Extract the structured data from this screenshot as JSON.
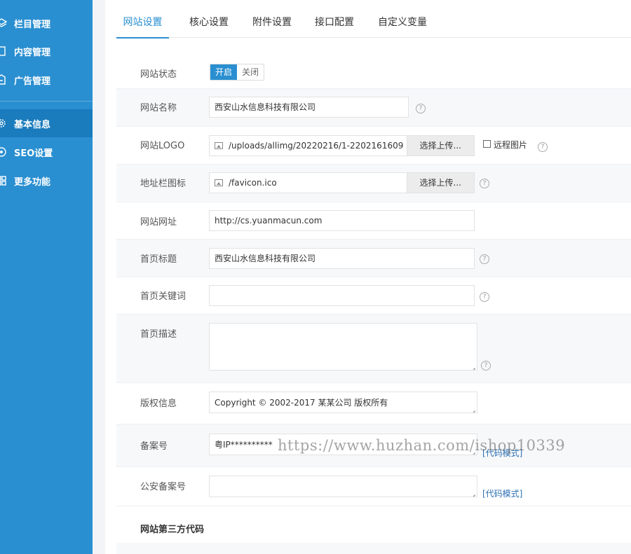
{
  "sidebar": {
    "items": [
      {
        "label": "栏目管理",
        "icon": "layers-icon"
      },
      {
        "label": "内容管理",
        "icon": "document-icon"
      },
      {
        "label": "广告管理",
        "icon": "ad-icon"
      },
      {
        "label": "基本信息",
        "icon": "gear-icon"
      },
      {
        "label": "SEO设置",
        "icon": "seo-icon"
      },
      {
        "label": "更多功能",
        "icon": "grid-icon"
      }
    ]
  },
  "tabs": [
    "网站设置",
    "核心设置",
    "附件设置",
    "接口配置",
    "自定义变量"
  ],
  "form": {
    "site_status": {
      "label": "网站状态",
      "on": "开启",
      "off": "关闭"
    },
    "site_name": {
      "label": "网站名称",
      "value": "西安山水信息科技有限公司"
    },
    "site_logo": {
      "label": "网站LOGO",
      "value": "/uploads/allimg/20220216/1-2202161609",
      "button": "选择上传...",
      "remote_label": "远程图片"
    },
    "favicon": {
      "label": "地址栏图标",
      "value": "/favicon.ico",
      "button": "选择上传..."
    },
    "site_url": {
      "label": "网站网址",
      "value": "http://cs.yuanmacun.com"
    },
    "home_title": {
      "label": "首页标题",
      "value": "西安山水信息科技有限公司"
    },
    "home_keywords": {
      "label": "首页关键词",
      "value": ""
    },
    "home_description": {
      "label": "首页描述",
      "value": ""
    },
    "copyright": {
      "label": "版权信息",
      "value": "Copyright © 2002-2017 某某公司 版权所有"
    },
    "icp": {
      "label": "备案号",
      "value": "粤IP**********",
      "code_mode": "[代码模式]"
    },
    "police_icp": {
      "label": "公安备案号",
      "value": "",
      "code_mode": "[代码模式]"
    },
    "third_party_title": "网站第三方代码"
  },
  "help_glyph": "?",
  "watermark": "https://www.huzhan.com/ishop10339",
  "colors": {
    "accent": "#2a8fd1",
    "sidebar_bg": "#2a8fd1",
    "sidebar_active": "#1a7bbd",
    "link": "#2a6fb3"
  }
}
